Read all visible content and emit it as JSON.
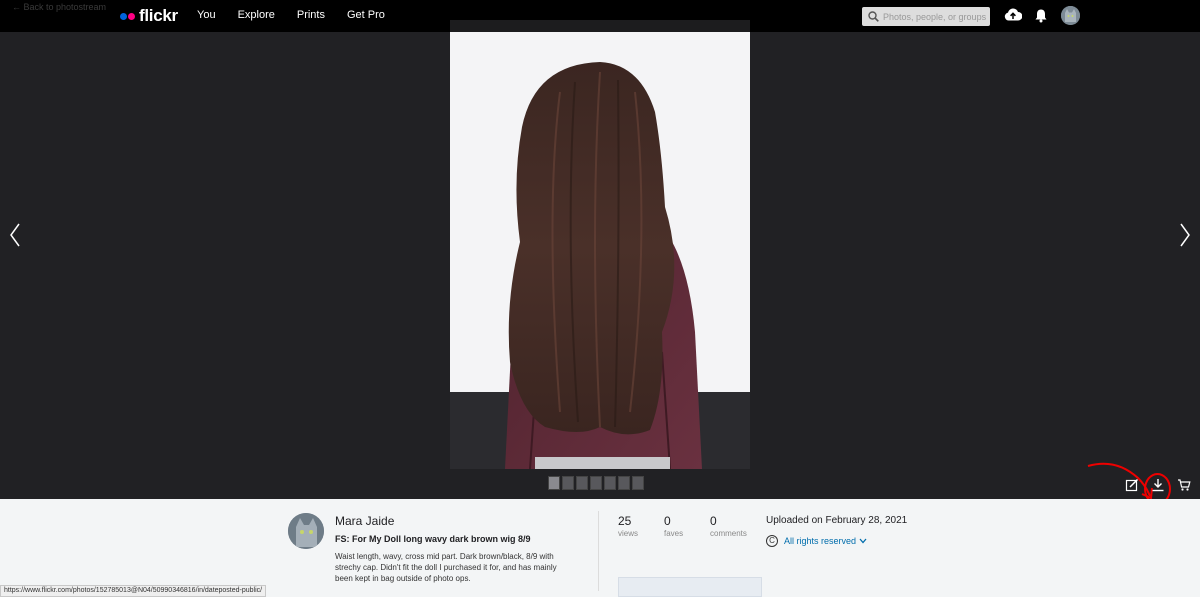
{
  "nav": {
    "back_label": "← Back to photostream",
    "logo_text": "flickr",
    "links": [
      "You",
      "Explore",
      "Prints",
      "Get Pro"
    ],
    "search_placeholder": "Photos, people, or groups"
  },
  "owner": {
    "name": "Mara Jaide"
  },
  "photo": {
    "title": "FS: For My Doll long wavy dark brown wig 8/9",
    "description": "Waist length, wavy, cross mid part. Dark brown/black, 8/9 with strechy cap. Didn't fit the doll I purchased it for, and has mainly been kept in bag outside of photo ops."
  },
  "stats": {
    "views": {
      "value": "25",
      "label": "views"
    },
    "faves": {
      "value": "0",
      "label": "faves"
    },
    "comments": {
      "value": "0",
      "label": "comments"
    }
  },
  "meta": {
    "uploaded": "Uploaded on February 28, 2021",
    "rights_symbol": "C",
    "rights": "All rights reserved"
  },
  "status_bar_url": "https://www.flickr.com/photos/152785013@N04/50990346816/in/dateposted-public/",
  "colors": {
    "brand_blue": "#0063dc",
    "brand_pink": "#ff0084",
    "link_blue": "#006dac",
    "annotation_red": "#e00000"
  }
}
